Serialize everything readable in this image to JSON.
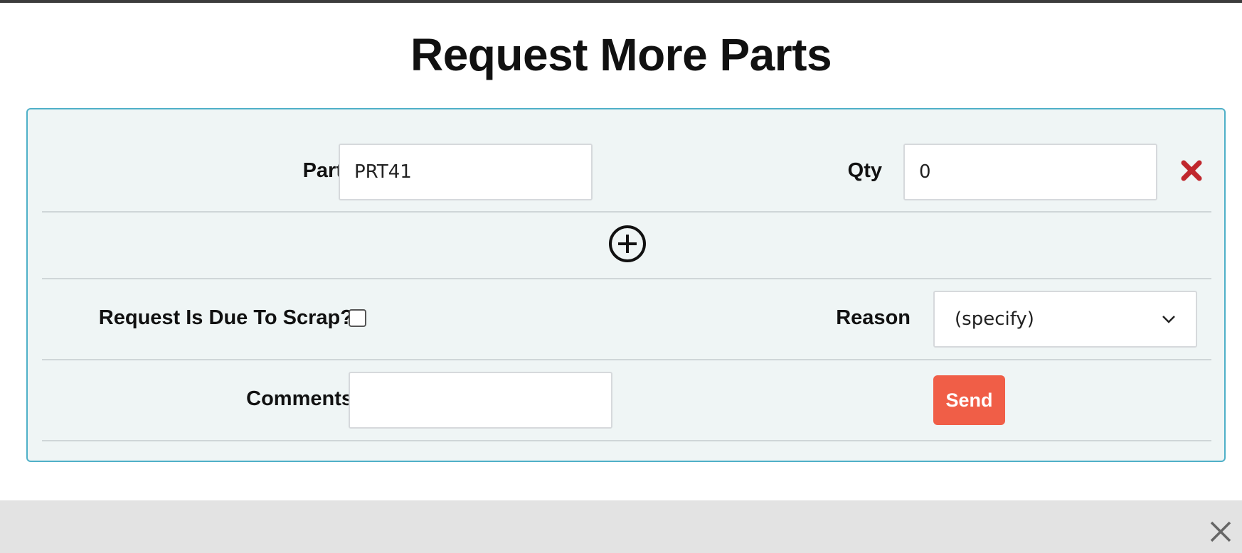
{
  "page": {
    "title": "Request More Parts"
  },
  "form": {
    "part_row": {
      "part_label": "Part",
      "part_value": "PRT41",
      "qty_label": "Qty",
      "qty_value": "0",
      "remove_icon": "red-x-icon"
    },
    "add_icon": "circle-plus-icon",
    "scrap_label": "Request Is Due To Scrap?",
    "scrap_checked": false,
    "reason_label": "Reason",
    "reason_selected": "(specify)",
    "comments_label": "Comments",
    "comments_value": "",
    "send_label": "Send"
  },
  "footer": {
    "close_icon": "close-x-icon"
  },
  "colors": {
    "panel_bg": "#eff5f5",
    "panel_border": "#4fb0c8",
    "send_button": "#f05e47",
    "remove_icon": "#c0272d",
    "footer_bg": "#e3e3e3"
  }
}
